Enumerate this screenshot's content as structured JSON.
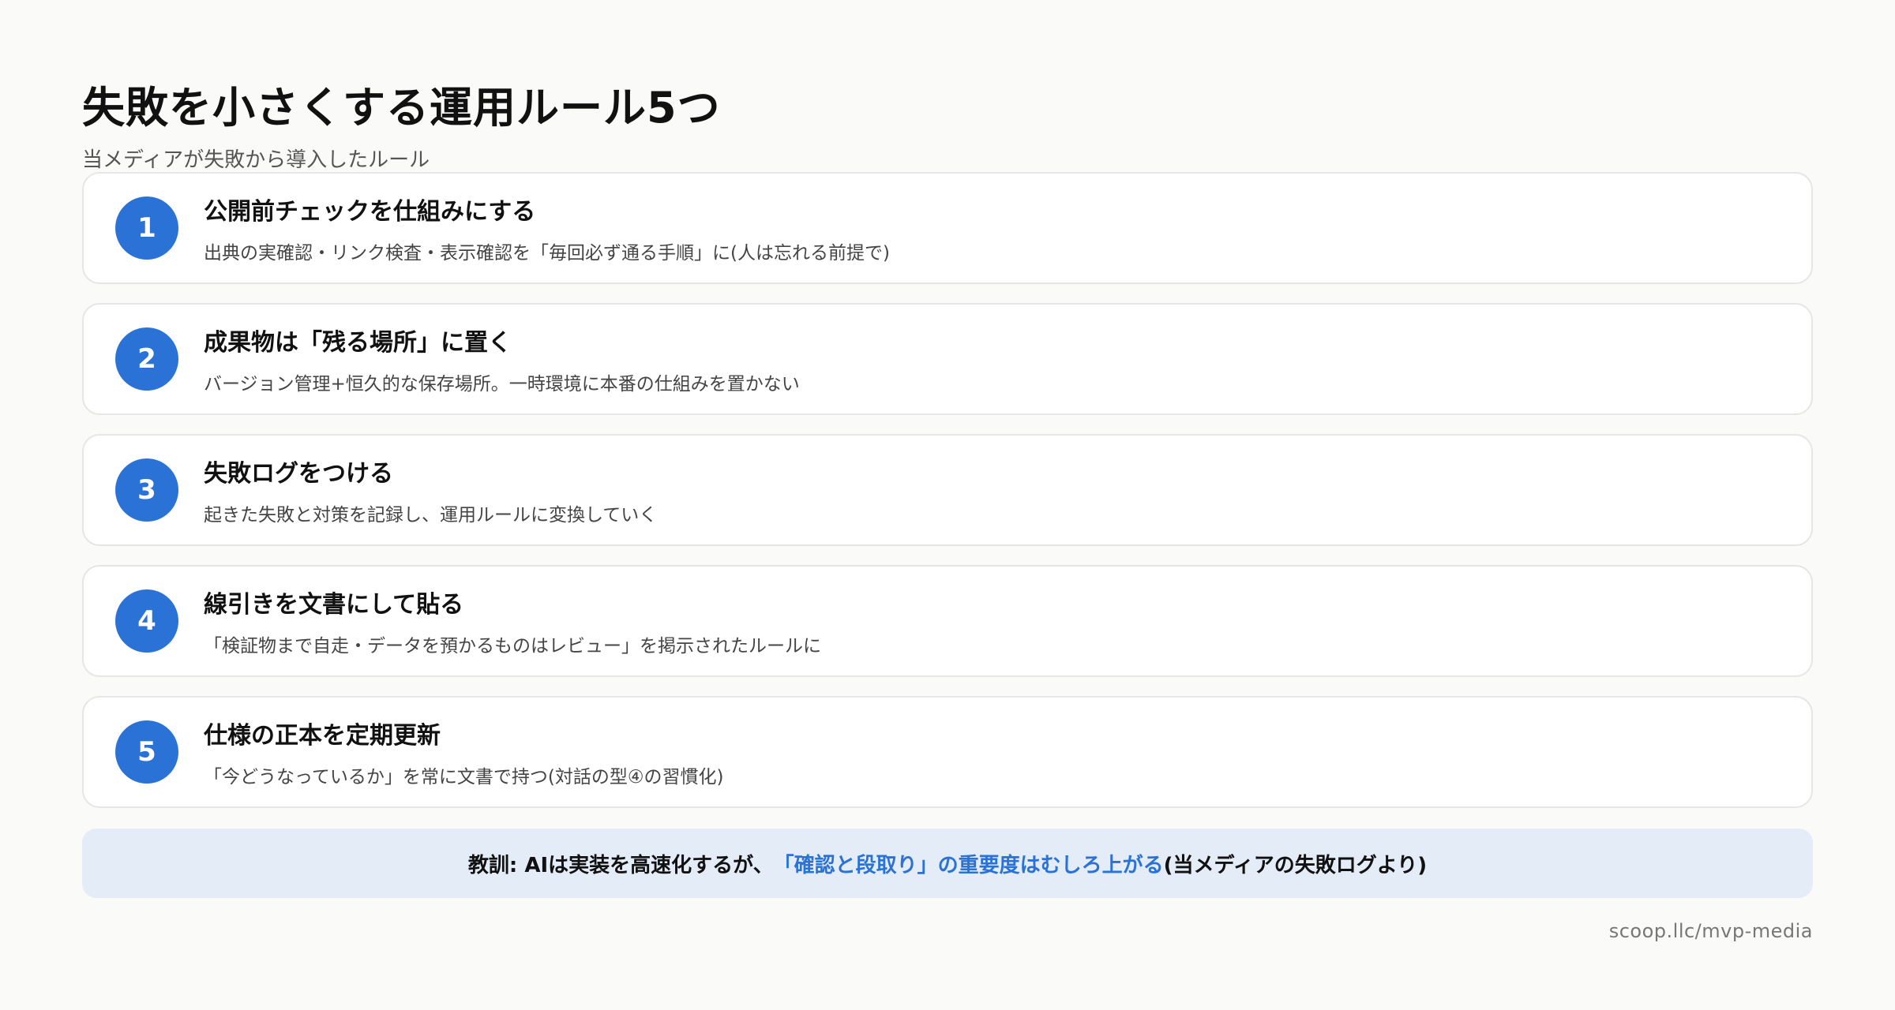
{
  "page": {
    "title": "失敗を小さくする運用ルール5つ",
    "subtitle": "当メディアが失敗から導入したルール"
  },
  "rules": [
    {
      "number": "1",
      "title": "公開前チェックを仕組みにする",
      "description": "出典の実確認・リンク検査・表示確認を「毎回必ず通る手順」に(人は忘れる前提で)"
    },
    {
      "number": "2",
      "title": "成果物は「残る場所」に置く",
      "description": "バージョン管理+恒久的な保存場所。一時環境に本番の仕組みを置かない"
    },
    {
      "number": "3",
      "title": "失敗ログをつける",
      "description": "起きた失敗と対策を記録し、運用ルールに変換していく"
    },
    {
      "number": "4",
      "title": "線引きを文書にして貼る",
      "description": "「検証物まで自走・データを預かるものはレビュー」を掲示されたルールに"
    },
    {
      "number": "5",
      "title": "仕様の正本を定期更新",
      "description": "「今どうなっているか」を常に文書で持つ(対話の型④の習慣化)"
    }
  ],
  "lesson": {
    "prefix": "教訓: AIは実装を高速化するが、",
    "highlight": "「確認と段取り」の重要度はむしろ上がる",
    "suffix": "(当メディアの失敗ログより)"
  },
  "footer": {
    "url": "scoop.llc/mvp-media"
  },
  "colors": {
    "accent": "#2a72d6",
    "background": "#fafaf9",
    "lesson_background": "#e3ecf7"
  }
}
